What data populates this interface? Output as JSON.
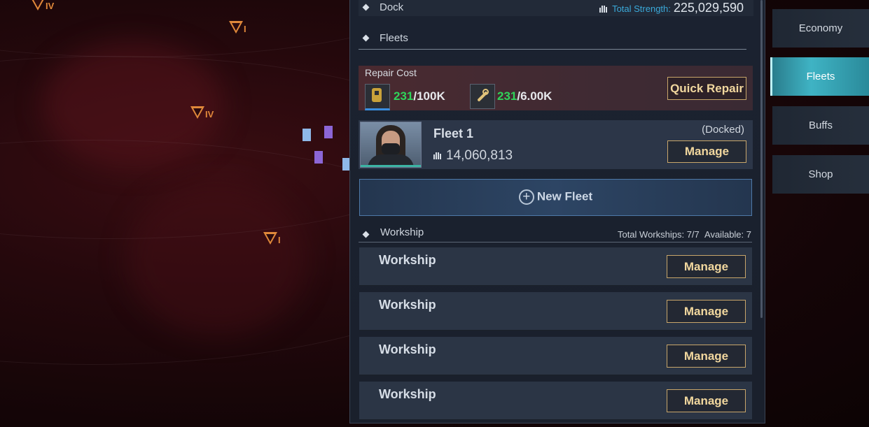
{
  "map": {
    "markers": [
      {
        "rank": "IV"
      },
      {
        "rank": "I"
      },
      {
        "rank": "IV"
      },
      {
        "rank": "I"
      }
    ]
  },
  "dock": {
    "label": "Dock",
    "total_strength_label": "Total Strength:",
    "total_strength_value": "225,029,590"
  },
  "fleets": {
    "label": "Fleets",
    "repair": {
      "title": "Repair Cost",
      "resource1_current": "231",
      "resource1_max": "/100K",
      "resource2_current": "231",
      "resource2_max": "/6.00K",
      "quick_repair_label": "Quick Repair"
    },
    "fleet_card": {
      "name": "Fleet 1",
      "power": "14,060,813",
      "status": "(Docked)",
      "manage_label": "Manage"
    },
    "new_fleet_label": "New Fleet"
  },
  "workship": {
    "label": "Workship",
    "total_text": "Total Workships: 7/7",
    "available_text": "Available: 7",
    "rows": [
      {
        "name": "Workship",
        "manage_label": "Manage"
      },
      {
        "name": "Workship",
        "manage_label": "Manage"
      },
      {
        "name": "Workship",
        "manage_label": "Manage"
      },
      {
        "name": "Workship",
        "manage_label": "Manage"
      }
    ]
  },
  "sidebar": {
    "tabs": [
      {
        "label": "Economy",
        "active": false
      },
      {
        "label": "Fleets",
        "active": true
      },
      {
        "label": "Buffs",
        "active": false
      },
      {
        "label": "Shop",
        "active": false
      }
    ]
  },
  "colors": {
    "accent_cyan": "#3fb3c4",
    "gold_button": "#c8a66a",
    "green_value": "#2fd35a",
    "strength_label": "#3aa9d9"
  }
}
